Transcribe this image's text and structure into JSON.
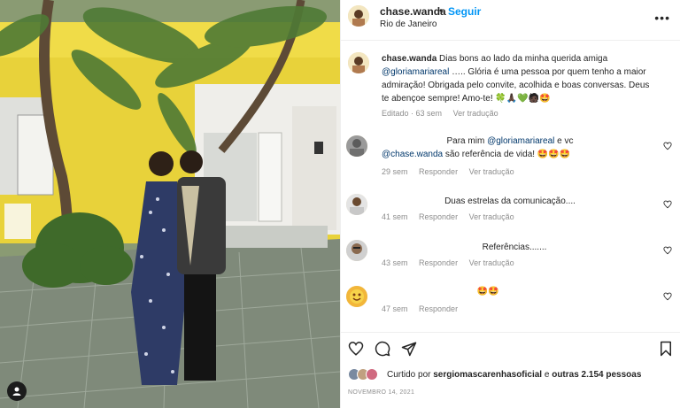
{
  "post": {
    "username": "chase.wanda",
    "separator": "•",
    "follow_label": "Seguir",
    "location": "Rio de Janeiro",
    "more_icon": "more-horizontal-icon",
    "caption": {
      "username": "chase.wanda",
      "text_start": "Dias bons ao lado da minha querida amiga",
      "mention": "@gloriamariareal",
      "text_end": "….. Glória é uma pessoa por quem tenho a maior admiração! Obrigada pelo convite, acolhida e boas conversas. Deus te abençoe sempre! Amo-te!",
      "emojis": "🍀🙏🏿💚🧑🏿🤩",
      "edited_time": "Editado · 63 sem",
      "translate_label": "Ver tradução"
    }
  },
  "comments": [
    {
      "line1_prefix": "Para mim ",
      "mention1": "@gloriamariareal",
      "line1_suffix": " e vc",
      "mention2": "@chase.wanda",
      "line2_suffix": " são referência de vida!",
      "emojis": "🤩🤩🤩",
      "time": "29 sem",
      "reply_label": "Responder",
      "translate_label": "Ver tradução"
    },
    {
      "text": "Duas estrelas da comunicação....",
      "time": "41 sem",
      "reply_label": "Responder",
      "translate_label": "Ver tradução"
    },
    {
      "text": "Referências.......",
      "time": "43 sem",
      "reply_label": "Responder",
      "translate_label": "Ver tradução"
    },
    {
      "text": "🤩🤩",
      "time": "47 sem",
      "reply_label": "Responder"
    }
  ],
  "actions": {
    "like_icon": "heart-icon",
    "comment_icon": "comment-icon",
    "share_icon": "share-icon",
    "save_icon": "bookmark-icon"
  },
  "likes": {
    "prefix": "Curtido por ",
    "user": "sergiomascarenhasoficial",
    "middle": " e ",
    "others": "outras 2.154 pessoas"
  },
  "date": "NOVEMBRO 14, 2021",
  "colors": {
    "link_blue": "#0095f6",
    "mention_blue": "#00376b",
    "meta_gray": "#8e8e8e",
    "text_dark": "#262626"
  }
}
